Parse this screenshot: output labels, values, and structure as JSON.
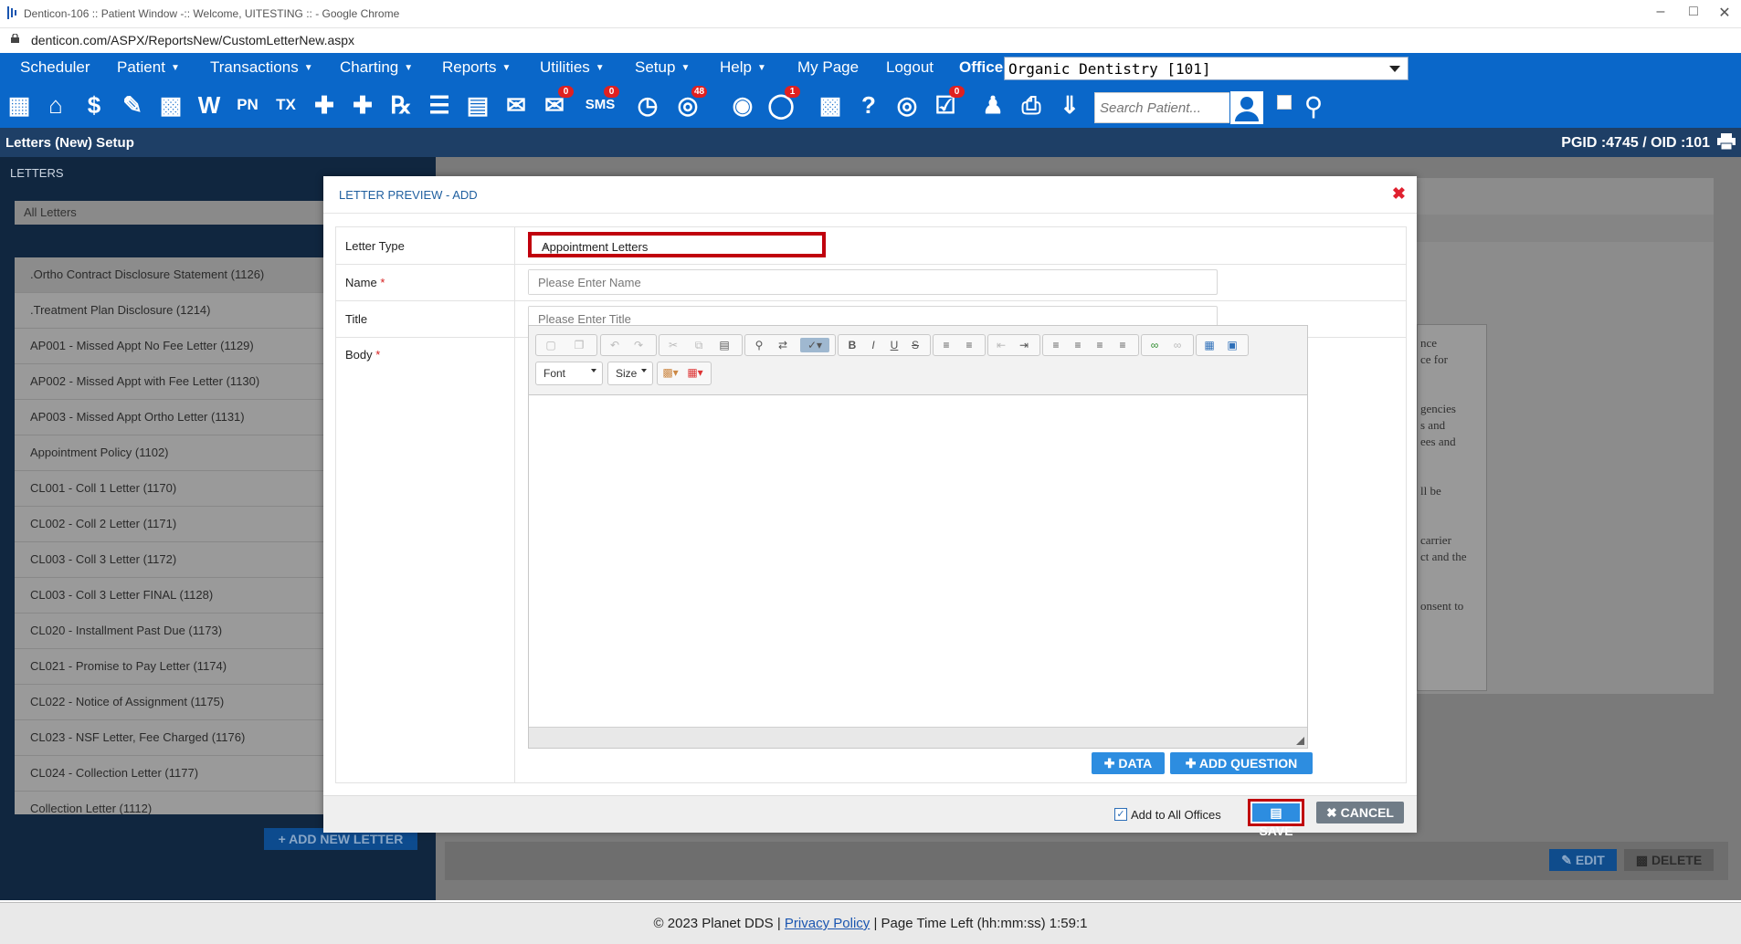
{
  "browser": {
    "window_title": "Denticon-106 :: Patient Window -:: Welcome, UITESTING :: - Google Chrome",
    "url": "denticon.com/ASPX/ReportsNew/CustomLetterNew.aspx"
  },
  "menu": {
    "items": [
      {
        "label": "Scheduler",
        "caret": false
      },
      {
        "label": "Patient",
        "caret": true
      },
      {
        "label": "Transactions",
        "caret": true
      },
      {
        "label": "Charting",
        "caret": true
      },
      {
        "label": "Reports",
        "caret": true
      },
      {
        "label": "Utilities",
        "caret": true
      },
      {
        "label": "Setup",
        "caret": true
      },
      {
        "label": "Help",
        "caret": true
      },
      {
        "label": "My Page",
        "caret": false
      },
      {
        "label": "Logout",
        "caret": false
      }
    ],
    "office_label": "Office",
    "office_value": "Organic Dentistry [101]"
  },
  "toolbar": {
    "search_placeholder": "Search Patient...",
    "badges": {
      "messages": "0",
      "sms": "0",
      "globe": "48",
      "alerts": "1",
      "tasks": "0"
    }
  },
  "page_header": {
    "title": "Letters (New) Setup",
    "ids": "PGID :4745  /  OID :101"
  },
  "left_panel": {
    "header": "LETTERS",
    "filter": "All Letters",
    "letters": [
      ".Ortho Contract Disclosure Statement (1126)",
      ".Treatment Plan Disclosure (1214)",
      "AP001 - Missed Appt No Fee Letter (1129)",
      "AP002 - Missed Appt with Fee Letter (1130)",
      "AP003 - Missed Appt Ortho Letter (1131)",
      "Appointment Policy (1102)",
      "CL001 - Coll 1 Letter (1170)",
      "CL002 - Coll 2 Letter (1171)",
      "CL003 - Coll 3 Letter (1172)",
      "CL003 - Coll 3 Letter FINAL (1128)",
      "CL020 - Installment Past Due (1173)",
      "CL021 - Promise to Pay Letter (1174)",
      "CL022 - Notice of Assignment (1175)",
      "CL023 - NSF Letter, Fee Charged (1176)",
      "CL024 - Collection Letter (1177)",
      "Collection Letter (1112)"
    ],
    "add_button": "ADD NEW LETTER"
  },
  "right_bg": {
    "fragments": [
      "nce",
      "ce for",
      "gencies",
      "s and",
      "ees and",
      "ll be",
      "carrier",
      "ct and the",
      "onsent to"
    ],
    "edit_label": "EDIT",
    "delete_label": "DELETE"
  },
  "modal": {
    "title": "LETTER PREVIEW - ADD",
    "fields": {
      "letter_type_label": "Letter Type",
      "letter_type_value": "Appointment Letters",
      "name_label": "Name",
      "name_placeholder": "Please Enter Name",
      "title_label": "Title",
      "title_placeholder": "Please Enter Title",
      "body_label": "Body",
      "required_mark": "*"
    },
    "editor": {
      "font_combo": "Font",
      "size_combo": "Size"
    },
    "data_button": "DATA",
    "add_question_button": "ADD QUESTION",
    "add_all_offices_label": "Add to All Offices",
    "add_all_offices_checked": true,
    "save_button": "SAVE",
    "cancel_button": "CANCEL"
  },
  "footer": {
    "copyright": "© 2023 Planet DDS |",
    "privacy_link": "Privacy Policy",
    "time_left": "| Page Time Left (hh:mm:ss) 1:59:1"
  },
  "colors": {
    "brand_blue": "#0a67c9",
    "accent_red": "#c0000d",
    "button_blue": "#2d8de0"
  }
}
